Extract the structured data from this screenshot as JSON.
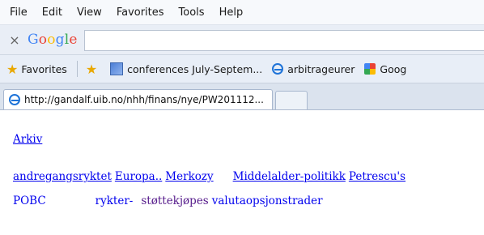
{
  "menu": [
    "File",
    "Edit",
    "View",
    "Favorites",
    "Tools",
    "Help"
  ],
  "search": {
    "logo": "Google",
    "close_label": "×"
  },
  "favorites_bar": {
    "favorites_label": "Favorites",
    "items": [
      {
        "label": "conferences July-Septem...",
        "icon": "grid-icon"
      },
      {
        "label": "arbitrageurer",
        "icon": "ie-icon"
      },
      {
        "label": "Goog",
        "icon": "google-icon"
      }
    ]
  },
  "tab": {
    "url": "http://gandalf.uib.no/nhh/finans/nye/PW201112..."
  },
  "page": {
    "archive_link": "Arkiv",
    "row1": [
      "andregangsryktet",
      "Europa..",
      "Merkozy",
      "Middelalder-politikk",
      "Petrescu's"
    ],
    "row2": [
      "POBC",
      "rykter-",
      "støttekjøpes",
      "valutaopsjonstrader"
    ]
  }
}
